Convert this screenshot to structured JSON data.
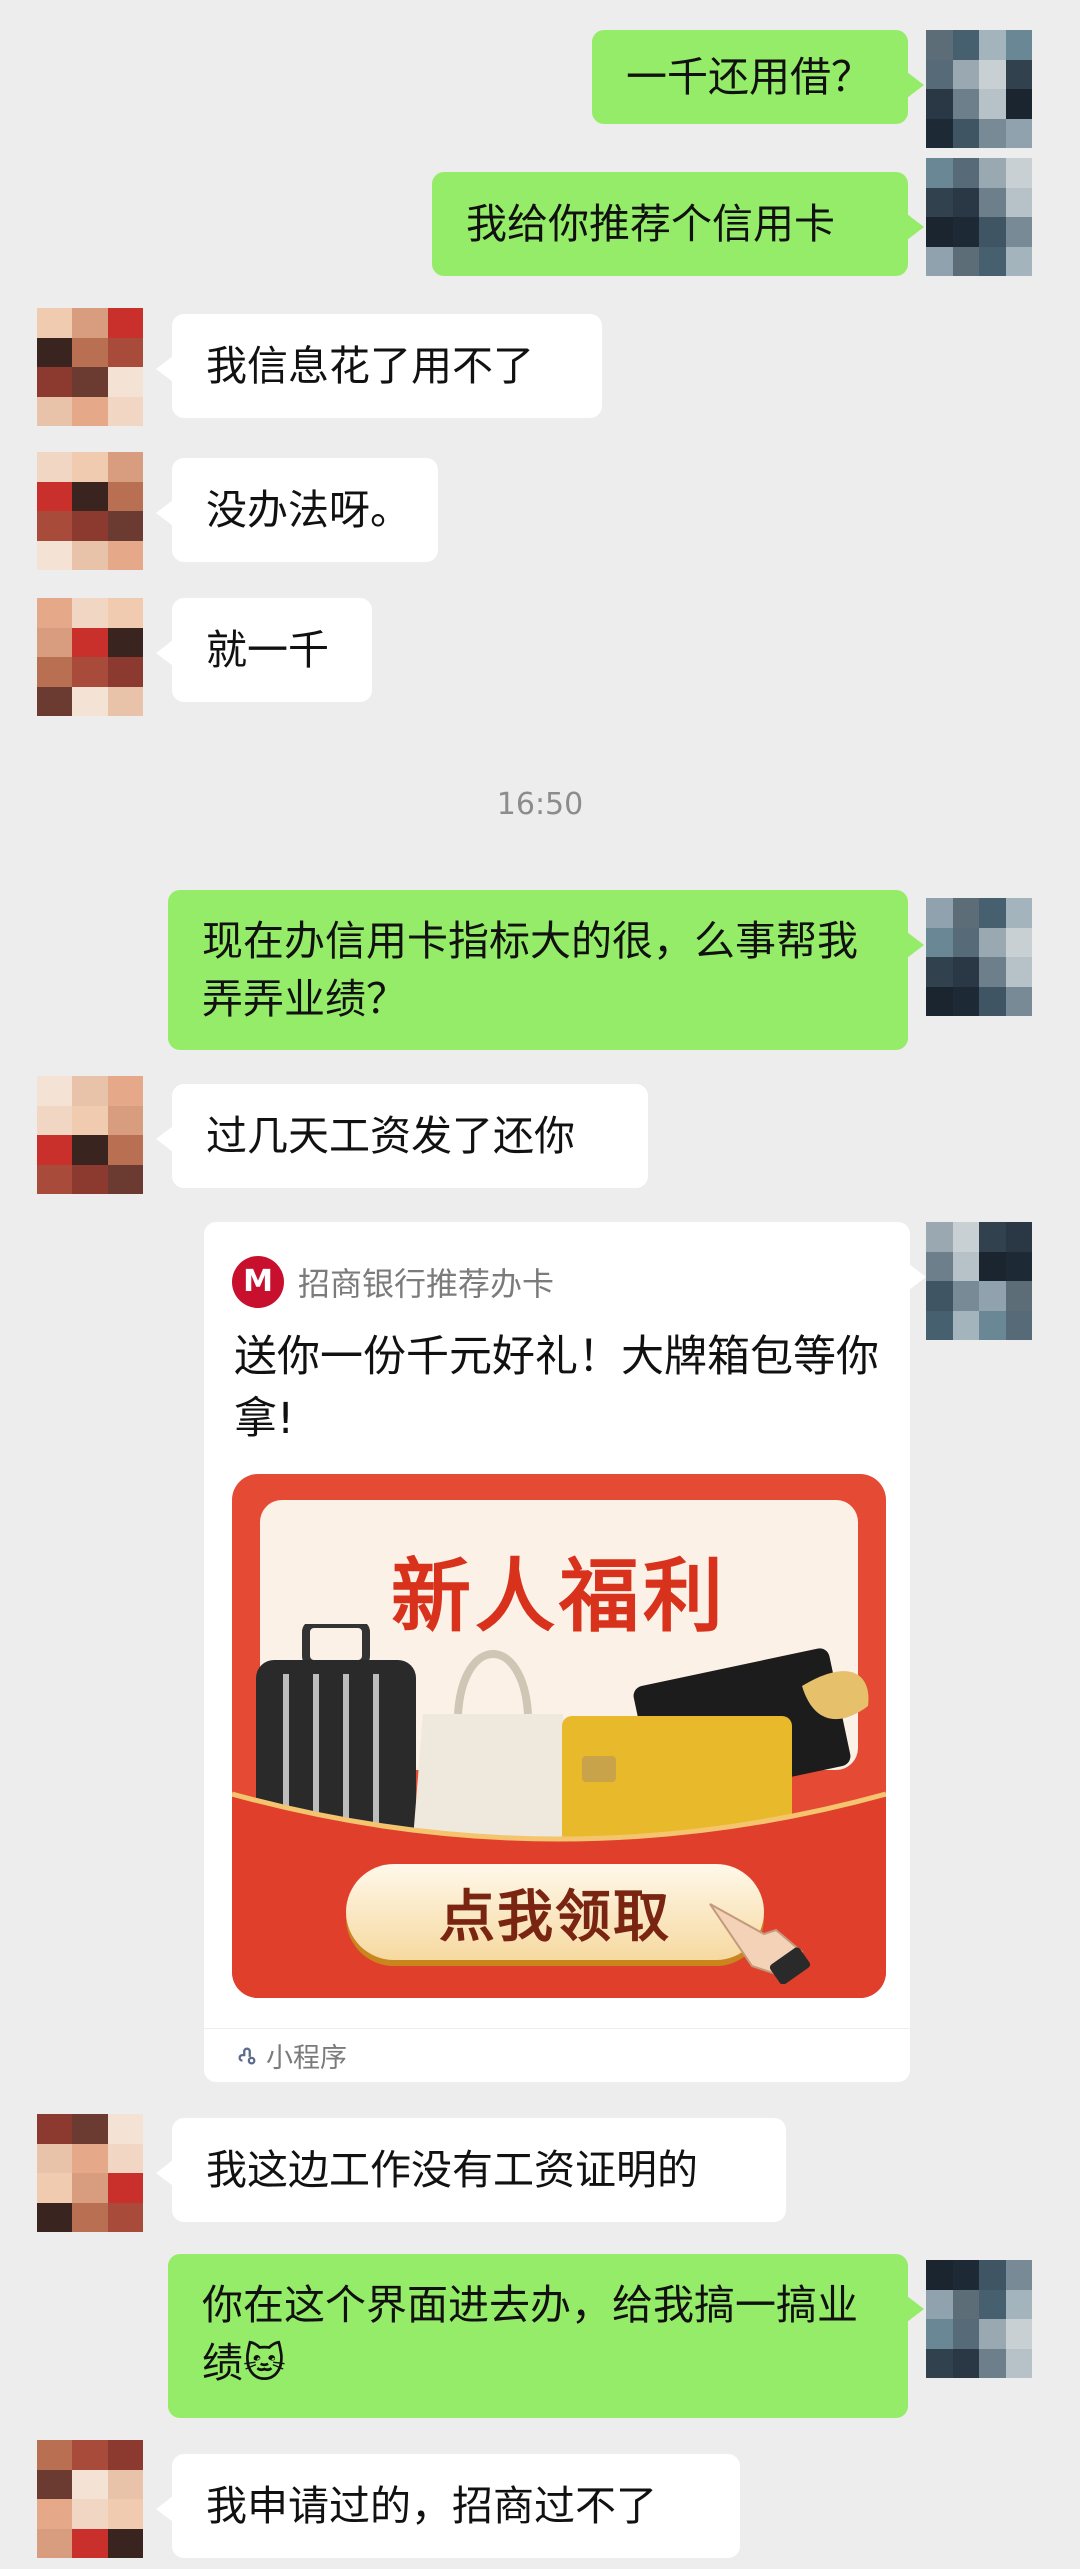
{
  "messages": [
    {
      "side": "me",
      "text": "一千还用借？"
    },
    {
      "side": "me",
      "text": "我给你推荐个信用卡"
    },
    {
      "side": "other",
      "text": "我信息花了用不了"
    },
    {
      "side": "other",
      "text": "没办法呀。"
    },
    {
      "side": "other",
      "text": "就一千"
    },
    {
      "side": "me",
      "text": "现在办信用卡指标大的很，么事帮我弄弄业绩？"
    },
    {
      "side": "other",
      "text": "过几天工资发了还你"
    },
    {
      "side": "other",
      "text": "我这边工作没有工资证明的"
    },
    {
      "side": "me",
      "text": "你在这个界面进去办，给我搞一搞业绩🐱"
    },
    {
      "side": "other",
      "text": "我申请过的，招商过不了"
    }
  ],
  "timestamp": "16:50",
  "card": {
    "brand": "招商银行推荐办卡",
    "title": "送你一份千元好礼！大牌箱包等你拿!",
    "banner_heading": "新人福利",
    "cta_label": "点我领取",
    "footer_label": "小程序"
  },
  "colors": {
    "me_bubble": "#95ec69",
    "other_bubble": "#ffffff",
    "background": "#ededed",
    "brand_red": "#c8102e"
  },
  "icons": [
    "mosaic-avatar",
    "cmb-logo-icon",
    "mini-program-icon"
  ]
}
